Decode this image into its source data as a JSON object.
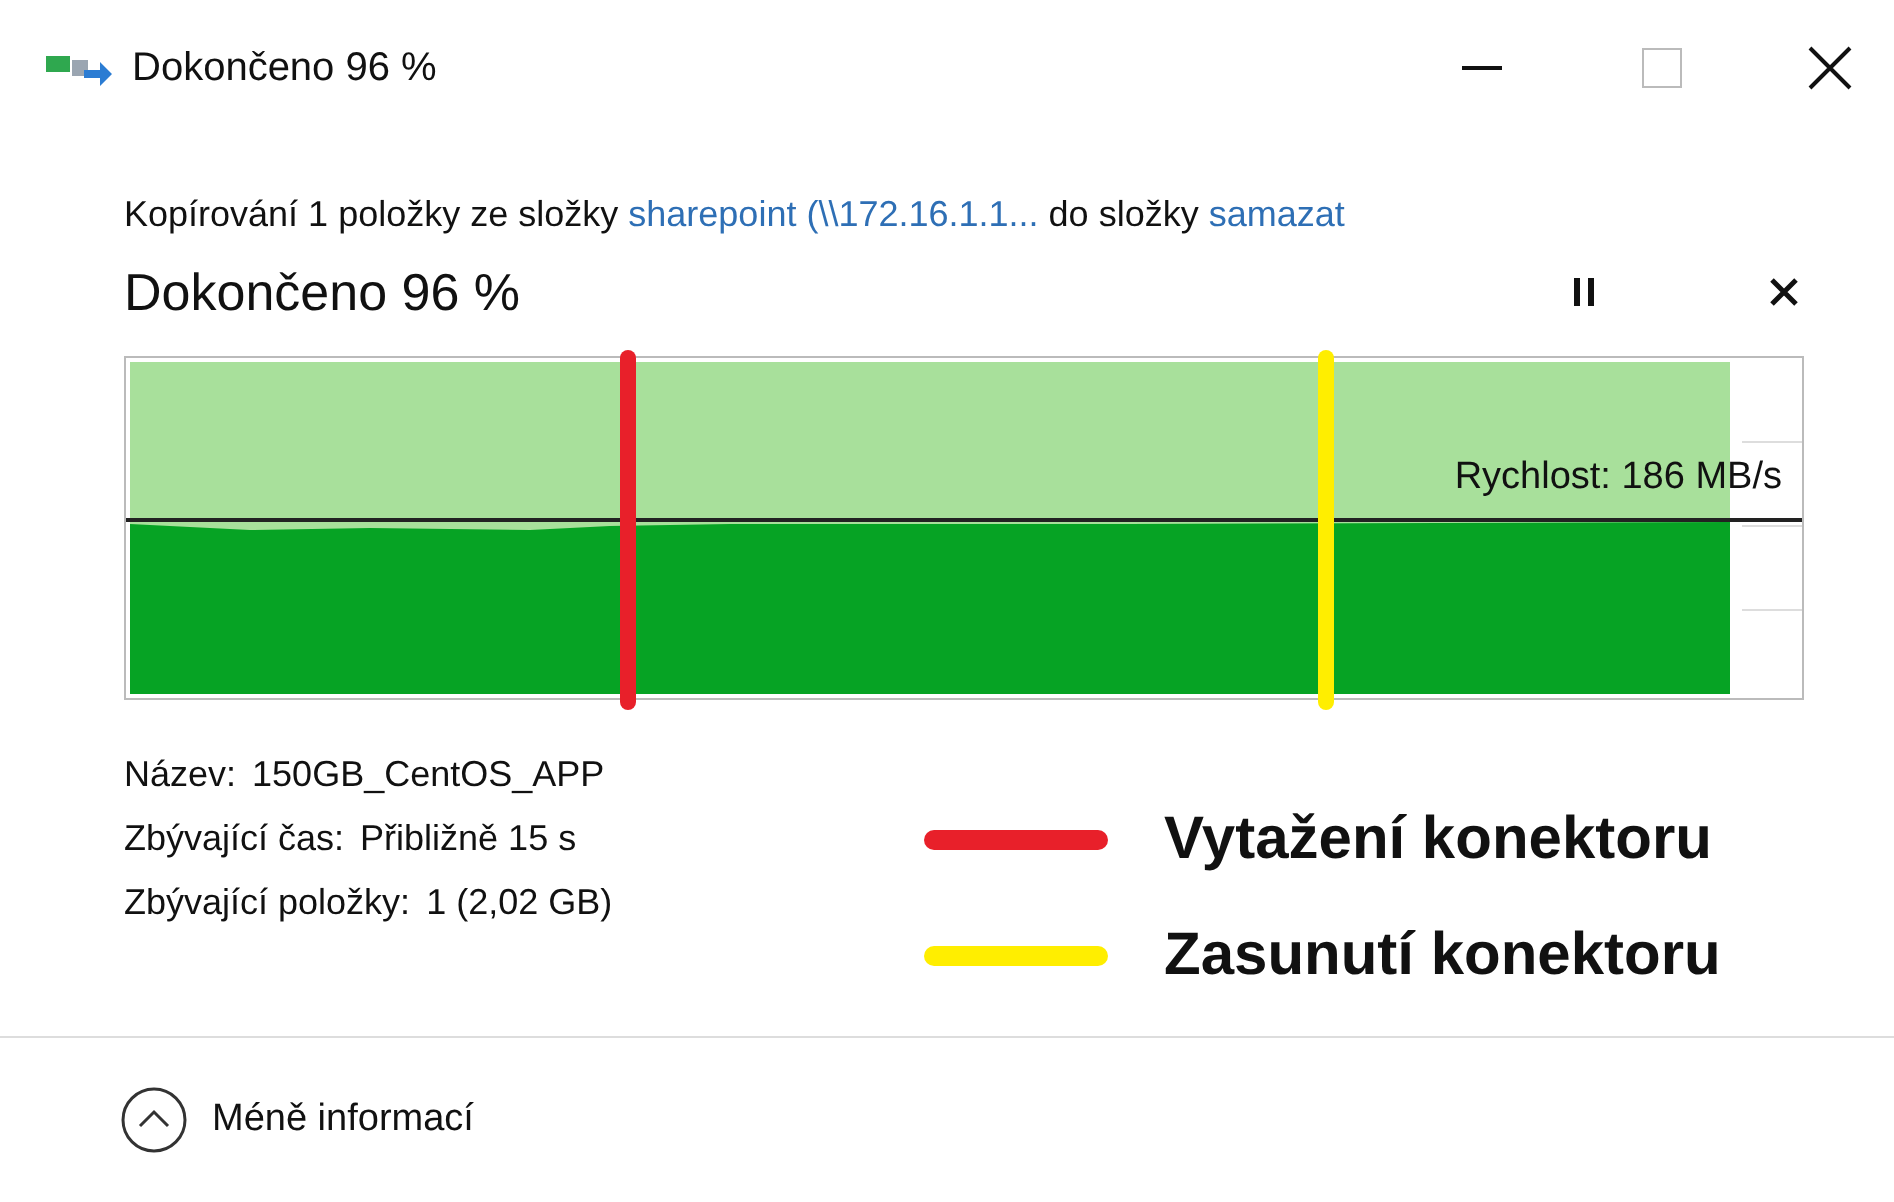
{
  "window": {
    "title": "Dokončeno 96 %"
  },
  "copy_line": {
    "prefix": "Kopírování 1 položky ze složky",
    "source": "sharepoint (\\\\172.16.1.1...",
    "middle": "do složky",
    "target": "samazat"
  },
  "progress": {
    "heading": "Dokončeno 96 %",
    "level": 0.96,
    "speed": "Rychlost: 186 MB/s"
  },
  "details": [
    {
      "label": "Název:",
      "value": "150GB_CentOS_APP"
    },
    {
      "label": "Zbývající čas:",
      "value": "Přibližně 15 s"
    },
    {
      "label": "Zbývající položky:",
      "value": "1 (2,02 GB)"
    }
  ],
  "legend": [
    {
      "label": "Vytažení konektoru",
      "color": "#e8202a"
    },
    {
      "label": "Zasunutí konektoru",
      "color": "#ffee00"
    }
  ],
  "footer": {
    "toggle": "Méně informací"
  }
}
